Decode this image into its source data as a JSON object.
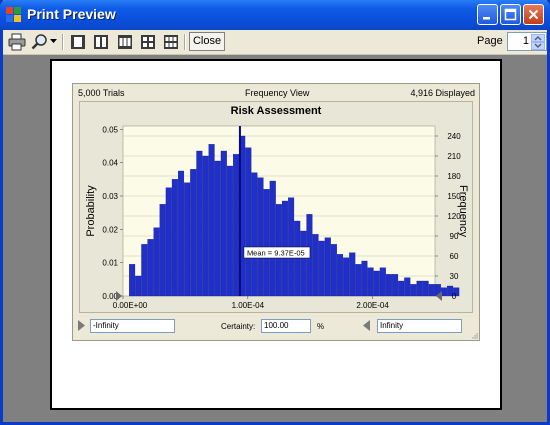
{
  "window": {
    "title": "Print Preview"
  },
  "toolbar": {
    "print_icon": "printer-icon",
    "zoom_icon": "magnifier-icon",
    "layout_icons": [
      "one-page-icon",
      "two-pages-icon",
      "three-pages-icon",
      "four-pages-icon",
      "six-pages-icon"
    ],
    "close_label": "Close",
    "page_label": "Page",
    "page_value": "1"
  },
  "report": {
    "trials": "5,000 Trials",
    "view": "Frequency View",
    "displayed": "4,916 Displayed",
    "certainty_label": "Certainty:",
    "certainty_value": "100.00",
    "certainty_unit": "%",
    "lower_value": "-Infinity",
    "upper_value": "Infinity"
  },
  "chart_data": {
    "type": "bar",
    "title": "Risk Assessment",
    "ylabel": "Probability",
    "y2label": "Frequency",
    "xlim": [
      0,
      0.00025
    ],
    "ylim": [
      0,
      0.051
    ],
    "y2lim": [
      0,
      255
    ],
    "xticks": [
      "0.00E+00",
      "1.00E-04",
      "2.00E-04"
    ],
    "xtick_values": [
      0,
      0.0001,
      0.0002
    ],
    "yticks": [
      "0.00",
      "0.01",
      "0.02",
      "0.03",
      "0.04",
      "0.05"
    ],
    "ytick_values": [
      0,
      0.01,
      0.02,
      0.03,
      0.04,
      0.05
    ],
    "y2ticks": [
      "0",
      "30",
      "60",
      "90",
      "120",
      "150",
      "180",
      "210",
      "240"
    ],
    "y2tick_values": [
      0,
      30,
      60,
      90,
      120,
      150,
      180,
      210,
      240
    ],
    "bin_start": 5e-06,
    "bin_width": 4.9e-06,
    "values": [
      0.0095,
      0.006,
      0.0155,
      0.017,
      0.0205,
      0.0275,
      0.0325,
      0.035,
      0.0375,
      0.034,
      0.038,
      0.0435,
      0.042,
      0.0455,
      0.0405,
      0.0435,
      0.039,
      0.0425,
      0.048,
      0.0445,
      0.037,
      0.0355,
      0.032,
      0.0345,
      0.0275,
      0.0285,
      0.0295,
      0.0225,
      0.0195,
      0.0245,
      0.0185,
      0.0165,
      0.0175,
      0.0155,
      0.0125,
      0.0115,
      0.013,
      0.0095,
      0.0105,
      0.0085,
      0.0075,
      0.0085,
      0.0065,
      0.0065,
      0.0045,
      0.0055,
      0.0035,
      0.0045,
      0.0045,
      0.0035,
      0.0035,
      0.0025,
      0.003,
      0.0025
    ],
    "bar_color": "#1f2fc8",
    "mean_value": 9.37e-05,
    "mean_label": "Mean = 9.37E-05",
    "mean_line_color": "#0a0a80"
  }
}
